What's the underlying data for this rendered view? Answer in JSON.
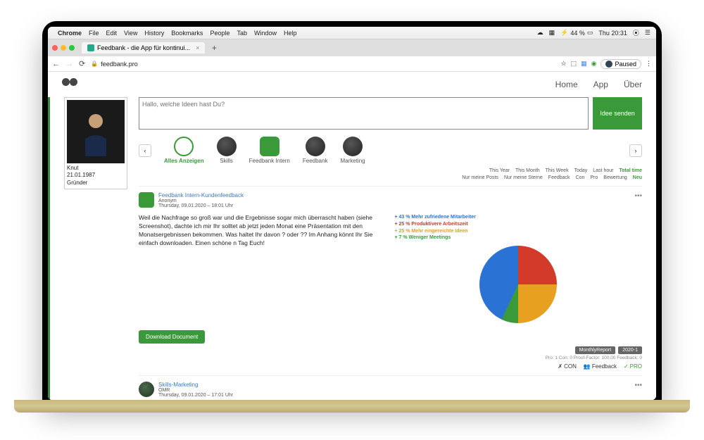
{
  "menubar": {
    "app": "Chrome",
    "items": [
      "File",
      "Edit",
      "View",
      "History",
      "Bookmarks",
      "People",
      "Tab",
      "Window",
      "Help"
    ],
    "battery": "44 %",
    "time": "Thu 20:31"
  },
  "tab": {
    "title": "Feedbank - die App für kontinui..."
  },
  "url": "feedbank.pro",
  "paused": "Paused",
  "nav": {
    "home": "Home",
    "app": "App",
    "about": "Über"
  },
  "profile": {
    "name": "Knut",
    "dob": "21.01.1987",
    "role": "Gründer"
  },
  "input": {
    "placeholder": "Hallo, welche Ideen hast Du?",
    "send": "Idee senden"
  },
  "categories": {
    "all": "Alles Anzeigen",
    "skills": "Skills",
    "intern": "Feedbank Intern",
    "feedbank": "Feedbank",
    "marketing": "Marketing"
  },
  "filters1": {
    "year": "This Year",
    "month": "This Month",
    "week": "This Week",
    "today": "Today",
    "hour": "Last hour",
    "total": "Total time"
  },
  "filters2": {
    "mine": "Nur meine Posts",
    "stars": "Nur meine Sterne",
    "feedback": "Feedback",
    "con": "Con",
    "pro": "Pro",
    "bewertung": "Bewertung",
    "neu": "Neu"
  },
  "post1": {
    "title": "Feedbank Intern-Kundenfeedback",
    "author": "Anonym",
    "time": "Thursday, 09.01.2020 – 18:01 Uhr",
    "text": "Weil die Nachfrage so groß war und die Ergebnisse sogar mich überrascht haben (siehe Screenshot), dachte ich mir Ihr solltet ab jetzt jeden Monat eine Präsentation mit den Monatsergebnissen bekommen. Was haltet Ihr davon ? oder ?? Im Anhang könnt Ihr Sie einfach downloaden. Einen schöne n Tag Euch!",
    "download": "Download Document",
    "tag1": "MonthlyReport",
    "tag2": "2020-1",
    "stats": "Pro: 1 Con: 0 Proof-Factor: 100.00 Feedback: 0"
  },
  "reactions": {
    "con": "CON",
    "feedback": "Feedback",
    "pro": "PRO"
  },
  "chart_data": {
    "type": "pie",
    "title": "",
    "series": [
      {
        "name": "+ 43 % Mehr zufriedene Mitarbeiter",
        "value": 43,
        "color": "#2a72d4"
      },
      {
        "name": "+ 25 % Produktivere Arbeitszeit",
        "value": 25,
        "color": "#d43a2a"
      },
      {
        "name": "+ 25 % Mehr eingereichte Ideen",
        "value": 25,
        "color": "#e8a020"
      },
      {
        "name": "+ 7 % Weniger Meetings",
        "value": 7,
        "color": "#3a9a3a"
      }
    ]
  },
  "post2": {
    "title": "Skills-Marketing",
    "author": "OMR",
    "time": "Thursday, 09.01.2020 – 17:01 Uhr"
  }
}
